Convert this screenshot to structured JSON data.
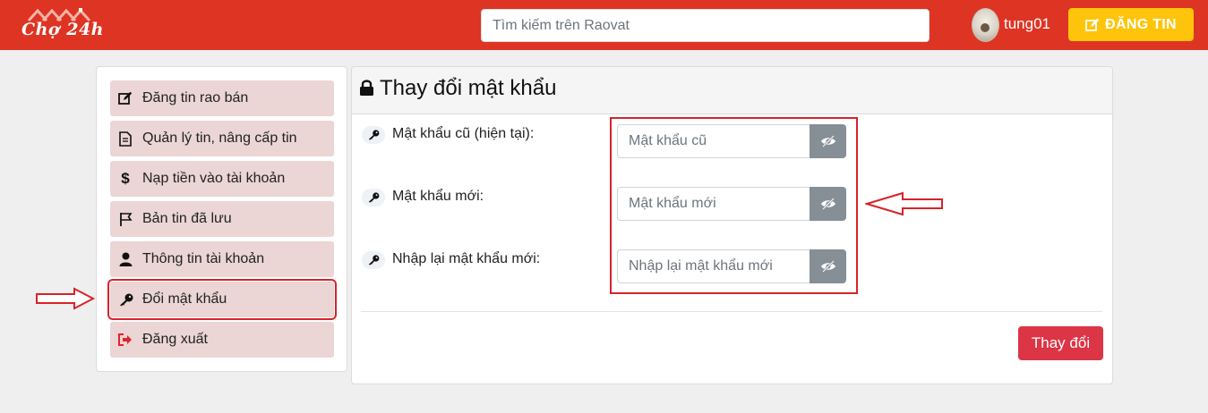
{
  "header": {
    "logo_text": "Chợ 24h",
    "search_placeholder": "Tìm kiếm trên Raovat",
    "username": "tung01",
    "post_button": "ĐĂNG TIN"
  },
  "sidebar": {
    "items": [
      {
        "label": "Đăng tin rao bán",
        "icon": "edit-icon"
      },
      {
        "label": "Quản lý tin, nâng cấp tin",
        "icon": "document-icon"
      },
      {
        "label": "Nạp tiền vào tài khoản",
        "icon": "dollar-icon"
      },
      {
        "label": "Bản tin đã lưu",
        "icon": "flag-icon"
      },
      {
        "label": "Thông tin tài khoản",
        "icon": "user-icon"
      },
      {
        "label": "Đổi mật khẩu",
        "icon": "key-icon",
        "active": true
      },
      {
        "label": "Đăng xuất",
        "icon": "sign-out-icon"
      }
    ]
  },
  "main": {
    "title": "Thay đổi mật khẩu",
    "fields": [
      {
        "label": "Mật khẩu cũ (hiện tại):",
        "placeholder": "Mật khẩu cũ",
        "value": ""
      },
      {
        "label": "Mật khẩu mới:",
        "placeholder": "Mật khẩu mới",
        "value": ""
      },
      {
        "label": "Nhập lại mật khẩu mới:",
        "placeholder": "Nhập lại mật khẩu mới",
        "value": ""
      }
    ],
    "submit_label": "Thay đổi"
  },
  "colors": {
    "header_bg": "#de3423",
    "post_button_bg": "#fdc40b",
    "sidebar_item_bg": "#ebd5d5",
    "submit_bg": "#dc3545",
    "annotation_red": "#d8232a",
    "eye_button_bg": "#868e96"
  }
}
